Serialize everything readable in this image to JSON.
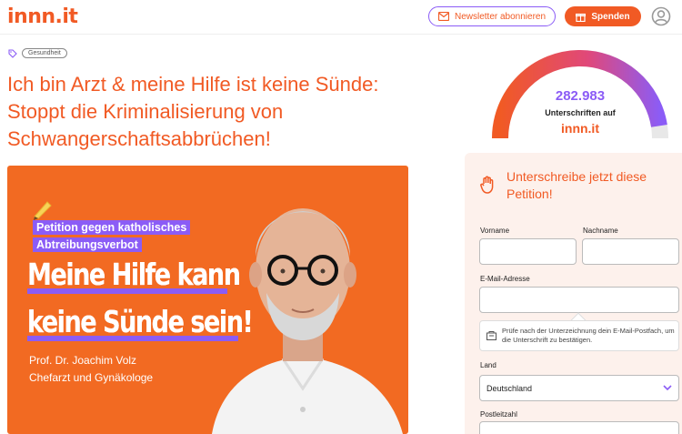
{
  "header": {
    "logo": "innn.it",
    "newsletter_label": "Newsletter abonnieren",
    "donate_label": "Spenden"
  },
  "tag": {
    "label": "Gesundheit"
  },
  "title": "Ich bin Arzt & meine Hilfe ist keine Sünde: Stoppt die Kriminalisierung von Schwangerschaftsabbrüchen!",
  "hero": {
    "pill_line1": "Petition gegen katholisches",
    "pill_line2": "Abtreibungsverbot",
    "headline_line1": "Meine Hilfe kann",
    "headline_line2": "keine Sünde sein!",
    "person_name": "Prof. Dr. Joachim Volz",
    "person_role": "Chefarzt und Gynäkologe"
  },
  "counter": {
    "count": "282.983",
    "label": "Unterschriften auf",
    "site": "innn.it",
    "progress_fraction": 0.95
  },
  "form": {
    "heading": "Unterschreibe jetzt diese Petition!",
    "first_name_label": "Vorname",
    "last_name_label": "Nachname",
    "email_label": "E-Mail-Adresse",
    "email_hint": "Prüfe nach der Unterzeichnung dein E-Mail-Postfach, um die Unterschrift zu bestätigen.",
    "country_label": "Land",
    "country_value": "Deutschland",
    "postal_label": "Postleitzahl"
  },
  "colors": {
    "brand_orange": "#f15a24",
    "brand_purple": "#8b5cf6",
    "panel_bg": "#fdf1ec"
  }
}
